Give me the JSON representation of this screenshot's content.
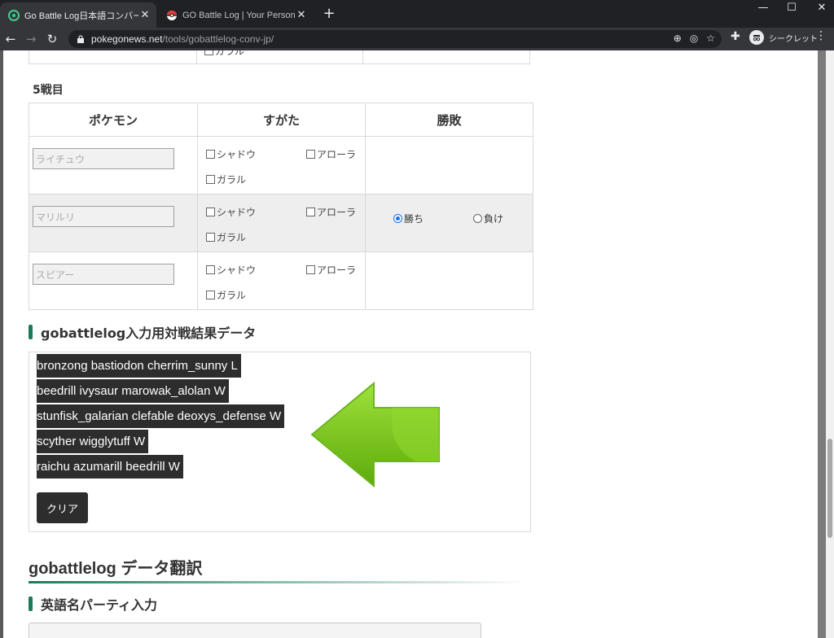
{
  "browser": {
    "tabs": [
      {
        "title": "Go Battle Log日本語コンバーター | ",
        "favicon": "pokegonews-icon",
        "active": true
      },
      {
        "title": "GO Battle Log | Your Personal Ba",
        "favicon": "pokeball-icon",
        "active": false
      }
    ],
    "close_glyph": "✕",
    "new_tab_glyph": "+",
    "url_host": "pokegonews.net",
    "url_path": "/tools/gobattlelog-conv-jp/",
    "incognito_label": "シークレット"
  },
  "page": {
    "battle5": {
      "heading": "5戦目",
      "headers": [
        "ポケモン",
        "すがた",
        "勝敗"
      ],
      "form_labels": {
        "shadow": "シャドウ",
        "alola": "アローラ",
        "galar": "ガラル"
      },
      "partial_row_label": "ガラル",
      "rows": [
        {
          "placeholder": "ライチュウ",
          "result_shown": false
        },
        {
          "placeholder": "マリルリ",
          "result_shown": true
        },
        {
          "placeholder": "スピアー",
          "result_shown": false
        }
      ],
      "result_options": {
        "win": "勝ち",
        "lose": "負け",
        "selected": "win"
      }
    },
    "output_section": {
      "heading": "gobattlelog入力用対戦結果データ",
      "lines": [
        "bronzong bastiodon cherrim_sunny L",
        "beedrill ivysaur marowak_alolan W",
        "stunfisk_galarian clefable deoxys_defense W",
        "scyther wigglytuff W",
        "raichu azumarill beedrill W"
      ],
      "clear_label": "クリア"
    },
    "translate_title": "gobattlelog データ翻訳",
    "party_heading": "英語名パーティ入力"
  },
  "colors": {
    "accent": "#1c7a5a",
    "arrow": "#7ac70f",
    "selection_bg": "#2d2d2d"
  }
}
